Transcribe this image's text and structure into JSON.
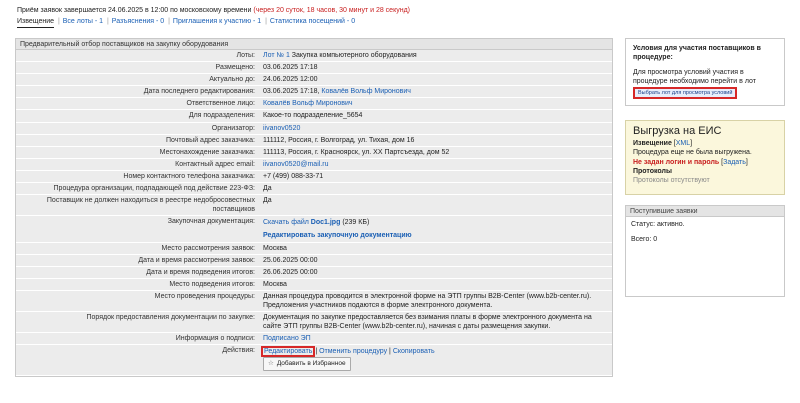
{
  "header": {
    "deadline_prefix": "Приём заявок завершается 24.06.2025 в 12:00 по московскому времени",
    "deadline_remaining": "(через 20 суток, 18 часов, 30 минут и 28 секунд)",
    "tabs": [
      {
        "label": "Извещение"
      },
      {
        "label": "Все лоты - 1"
      },
      {
        "label": "Разъяснения - 0"
      },
      {
        "label": "Приглашения к участию - 1"
      },
      {
        "label": "Статистика посещений - 0"
      }
    ]
  },
  "main": {
    "title": "Предварительный отбор поставщиков на закупку оборудования",
    "lot": {
      "label": "Лоты:",
      "link": "Лот № 1",
      "text": "Закупка компьютерного оборудования"
    },
    "placed": {
      "label": "Размещено:",
      "value": "03.06.2025 17:18"
    },
    "actual": {
      "label": "Актуально до:",
      "value": "24.06.2025 12:00"
    },
    "last_edit": {
      "label": "Дата последнего редактирования:",
      "value": "03.06.2025 17:18,",
      "link": "Ковалёв Вольф Миронович"
    },
    "responsible": {
      "label": "Ответственное лицо:",
      "link": "Ковалёв Вольф Миронович"
    },
    "department": {
      "label": "Для подразделения:",
      "value": "Какое-то подразделение_5654"
    },
    "organizer": {
      "label": "Организатор:",
      "link": "iivanov0520"
    },
    "postal": {
      "label": "Почтовый адрес заказчика:",
      "value": "111112, Россия, г. Волгоград, ул. Тихая, дом 16"
    },
    "location": {
      "label": "Местонахождение заказчика:",
      "value": "111113, Россия, г. Красноярск, ул. ХХ Партсъезда, дом 52"
    },
    "email": {
      "label": "Контактный адрес email:",
      "link": "iivanov0520@mail.ru"
    },
    "phone": {
      "label": "Номер контактного телефона заказчика:",
      "value": "+7 (499) 088-33-71"
    },
    "law223": {
      "label": "Процедура организации, подпадающей под действие 223-ФЗ:",
      "value": "Да"
    },
    "registry": {
      "label": "Поставщик не должен находиться в реестре недобросовестных поставщиков",
      "value": "Да"
    },
    "docs": {
      "label": "Закупочная документация:",
      "download": "Скачать файл",
      "file": "Doc1.jpg",
      "size": "(239 КБ)",
      "edit_link": "Редактировать закупочную документацию"
    },
    "review_place": {
      "label": "Место рассмотрения заявок:",
      "value": "Москва"
    },
    "review_date": {
      "label": "Дата и время рассмотрения заявок:",
      "value": "25.06.2025 00:00"
    },
    "results_date": {
      "label": "Дата и время подведения итогов:",
      "value": "26.06.2025 00:00"
    },
    "results_place": {
      "label": "Место подведения итогов:",
      "value": "Москва"
    },
    "procedure_place": {
      "label": "Место проведения процедуры:",
      "value": "Данная процедура проводится в электронной форме на ЭТП группы B2B-Center (www.b2b-center.ru). Предложения участников подаются в форме электронного документа."
    },
    "docs_order": {
      "label": "Порядок предоставления документации по закупке:",
      "value": "Документация по закупке предоставляется без взимания платы в форме электронного документа на сайте ЭТП группы B2B-Center (www.b2b-center.ru), начиная с даты размещения закупки."
    },
    "signature": {
      "label": "Информация о подписи:",
      "link": "Подписано ЭП"
    },
    "actions": {
      "label": "Действия:",
      "edit": "Редактировать",
      "cancel": "Отменить процедуру",
      "copy": "Скопировать",
      "favorite": "Добавить в Избранное"
    }
  },
  "conditions": {
    "title": "Условия для участия поставщиков в процедуре:",
    "text": "Для просмотра условий участия в процедуре необходимо перейти в лот",
    "button": "Выбрать лот для просмотра условий"
  },
  "eis": {
    "title": "Выгрузка на ЕИС",
    "notice_label": "Извещение",
    "xml": "XML",
    "not_uploaded": "Процедура еще не была выгружена.",
    "no_login": "Не задан логин и пароль",
    "set_link": "Задать",
    "protocols_label": "Протоколы",
    "protocols_absent": "Протоколы отсутствуют"
  },
  "incoming": {
    "title": "Поступившие заявки",
    "status": "Статус: активно.",
    "total": "Всего: 0"
  }
}
